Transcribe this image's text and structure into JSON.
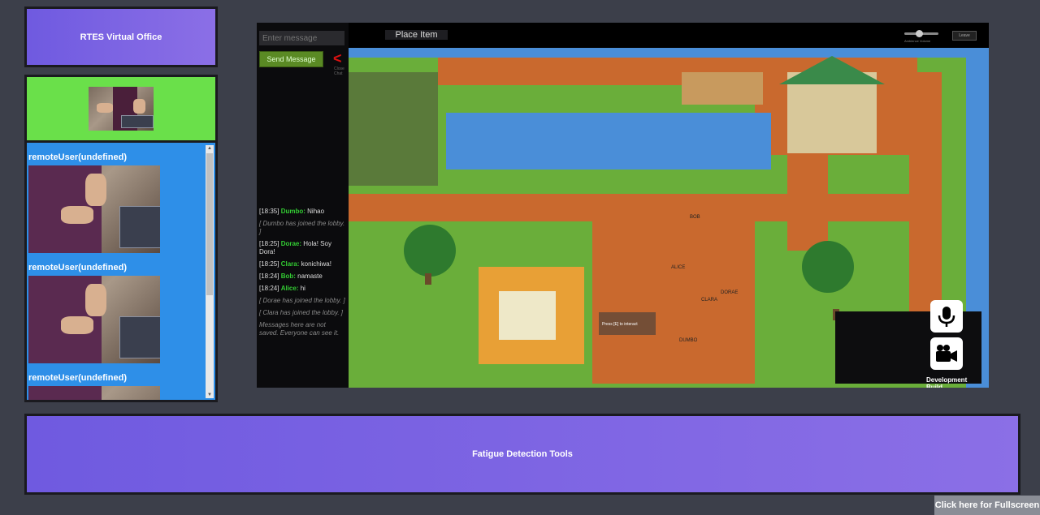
{
  "app": {
    "title": "RTES Virtual Office"
  },
  "remote_users": [
    {
      "label": "remoteUser(undefined)"
    },
    {
      "label": "remoteUser(undefined)"
    },
    {
      "label": "remoteUser(undefined)"
    }
  ],
  "chat": {
    "input_placeholder": "Enter message",
    "send_label": "Send Message",
    "close_label": "Close Chat",
    "messages": [
      {
        "time": "[18:35]",
        "name": "Dumbo:",
        "text": "Nihao"
      },
      {
        "system": "[ Dumbo has joined the lobby. ]"
      },
      {
        "time": "[18:25]",
        "name": "Dorae:",
        "text": "Hola! Soy Dora!"
      },
      {
        "time": "[18:25]",
        "name": "Clara:",
        "text": "konichiwa!"
      },
      {
        "time": "[18:24]",
        "name": "Bob:",
        "text": "namaste"
      },
      {
        "time": "[18:24]",
        "name": "Alice:",
        "text": "hi"
      },
      {
        "system": "[ Dorae has joined the lobby. ]"
      },
      {
        "system": "[ Clara has joined the lobby. ]"
      },
      {
        "system": "Messages here are not saved. Everyone can see it."
      }
    ]
  },
  "game": {
    "place_item_label": "Place Item",
    "volume_label": "Ambience Volume",
    "leave_label": "Leave",
    "interact_hint": "Press [E] to interact",
    "players": [
      "BOB",
      "ALICE",
      "DORAE",
      "CLARA",
      "DUMBO"
    ],
    "dev_build_label": "Development Build"
  },
  "fatigue": {
    "label": "Fatigue Detection Tools"
  },
  "fullscreen": {
    "label": "Click here for Fullscreen"
  },
  "colors": {
    "purple": "#7a63e3",
    "green": "#6ae04a",
    "blue": "#2e8fe8",
    "send": "#5a8a24"
  },
  "icons": [
    "mic-icon",
    "camera-icon",
    "close-chat-icon"
  ]
}
